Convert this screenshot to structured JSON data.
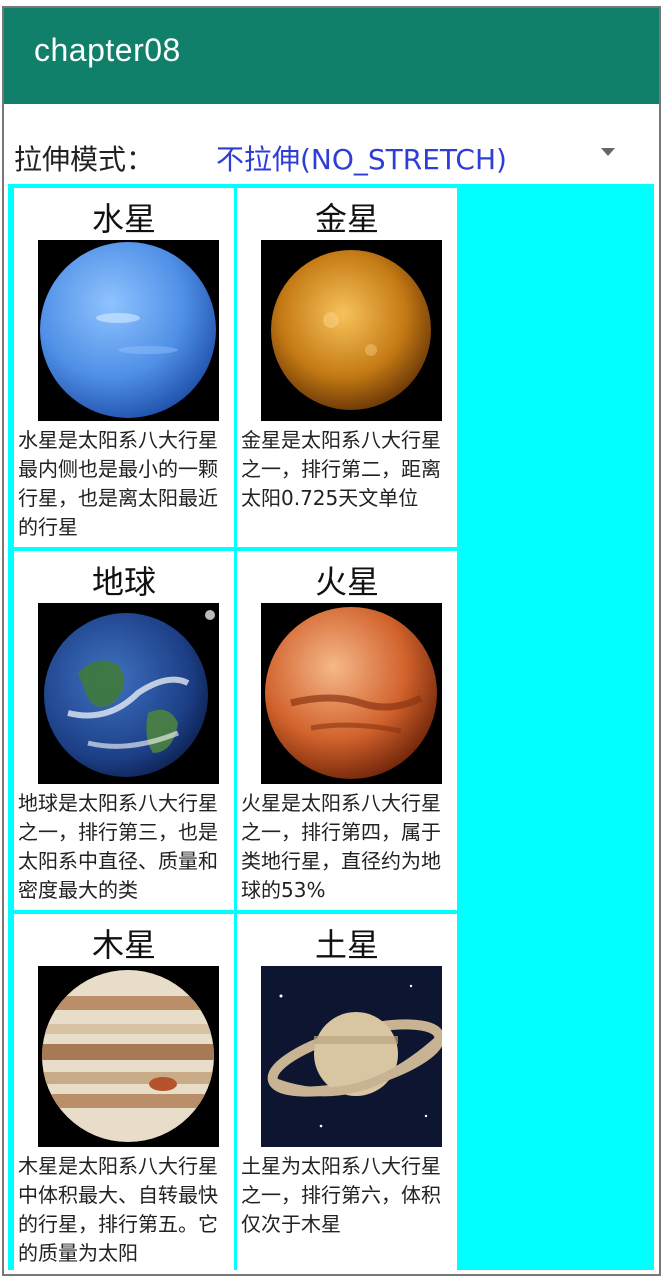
{
  "app": {
    "title": "chapter08"
  },
  "spinner": {
    "label": "拉伸模式：",
    "selected": "不拉伸(NO_STRETCH)"
  },
  "planets": [
    {
      "name": "水星",
      "desc": "水星是太阳系八大行星最内侧也是最小的一颗行星，也是离太阳最近的行星"
    },
    {
      "name": "金星",
      "desc": "金星是太阳系八大行星之一，排行第二，距离太阳0.725天文单位"
    },
    {
      "name": "地球",
      "desc": "地球是太阳系八大行星之一，排行第三，也是太阳系中直径、质量和密度最大的类"
    },
    {
      "name": "火星",
      "desc": "火星是太阳系八大行星之一，排行第四，属于类地行星，直径约为地球的53%"
    },
    {
      "name": "木星",
      "desc": "木星是太阳系八大行星中体积最大、自转最快的行星，排行第五。它的质量为太阳"
    },
    {
      "name": "土星",
      "desc": "土星为太阳系八大行星之一，排行第六，体积仅次于木星"
    }
  ],
  "colors": {
    "appbar": "#11806a",
    "spinner_value": "#2d3dd6",
    "grid_background": "#00ffff"
  }
}
